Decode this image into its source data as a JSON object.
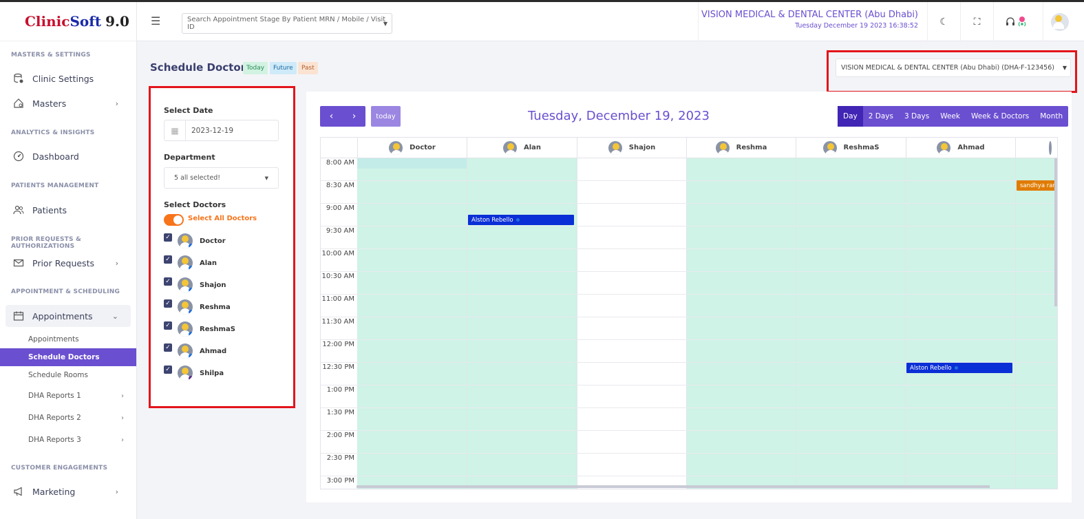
{
  "app": {
    "logo_a": "Clinic",
    "logo_b": "Soft",
    "logo_c": "9.0"
  },
  "sidebar": {
    "sections": {
      "masters": "MASTERS & SETTINGS",
      "analytics": "ANALYTICS & INSIGHTS",
      "patients": "PATIENTS MANAGEMENT",
      "prior": "PRIOR REQUESTS & AUTHORIZATIONS",
      "appointments": "APPOINTMENT & SCHEDULING",
      "customer": "CUSTOMER ENGAGEMENTS"
    },
    "items": {
      "clinic_settings": "Clinic Settings",
      "masters": "Masters",
      "dashboard": "Dashboard",
      "patients": "Patients",
      "prior_requests": "Prior Requests",
      "appointments": "Appointments",
      "marketing": "Marketing"
    },
    "sub": {
      "appointments": "Appointments",
      "schedule_doctors": "Schedule Doctors",
      "schedule_rooms": "Schedule Rooms",
      "dha1": "DHA Reports 1",
      "dha2": "DHA Reports 2",
      "dha3": "DHA Reports 3"
    }
  },
  "header": {
    "search_placeholder": "Search Appointment Stage By Patient MRN / Mobile / Visit ID",
    "clinic_name": "VISION MEDICAL & DENTAL CENTER (Abu Dhabi)",
    "datetime": "Tuesday December 19 2023 16:38:52"
  },
  "page": {
    "title": "Schedule Doctors",
    "badges": {
      "today": "Today",
      "future": "Future",
      "past": "Past"
    },
    "clinic_select": "VISION MEDICAL & DENTAL CENTER (Abu Dhabi) (DHA-F-123456)"
  },
  "filters": {
    "date_label": "Select Date",
    "date_value": "2023-12-19",
    "department_label": "Department",
    "department_value": "5 all selected!",
    "doctors_label": "Select Doctors",
    "select_all": "Select All Doctors",
    "doctors": [
      "Doctor",
      "Alan",
      "Shajon",
      "Reshma",
      "ReshmaS",
      "Ahmad",
      "Shilpa"
    ]
  },
  "calendar": {
    "today_btn": "today",
    "title": "Tuesday, December 19, 2023",
    "views": [
      "Day",
      "2 Days",
      "3 Days",
      "Week",
      "Week & Doctors",
      "Month"
    ],
    "active_view": "Day",
    "columns": [
      "Doctor",
      "Alan",
      "Shajon",
      "Reshma",
      "ReshmaS",
      "Ahmad"
    ],
    "times": [
      "8:00 AM",
      "8:30 AM",
      "9:00 AM",
      "9:30 AM",
      "10:00 AM",
      "10:30 AM",
      "11:00 AM",
      "11:30 AM",
      "12:00 PM",
      "12:30 PM",
      "1:00 PM",
      "1:30 PM",
      "2:00 PM",
      "2:30 PM",
      "3:00 PM"
    ],
    "events": [
      {
        "label": "Alston Rebello",
        "doctor": "Alan",
        "time": "9:15 AM",
        "color": "#0b2fd6"
      },
      {
        "label": "Alston Rebello",
        "doctor": "Ahmad",
        "time": "12:30 PM",
        "color": "#0b2fd6"
      },
      {
        "label": "sandhya rani",
        "doctor": "",
        "time": "8:30 AM",
        "color": "#e07b00"
      }
    ]
  },
  "colors": {
    "accent": "#6a4fd0",
    "available": "#cff3e6",
    "highlight_box": "#e3141b"
  }
}
